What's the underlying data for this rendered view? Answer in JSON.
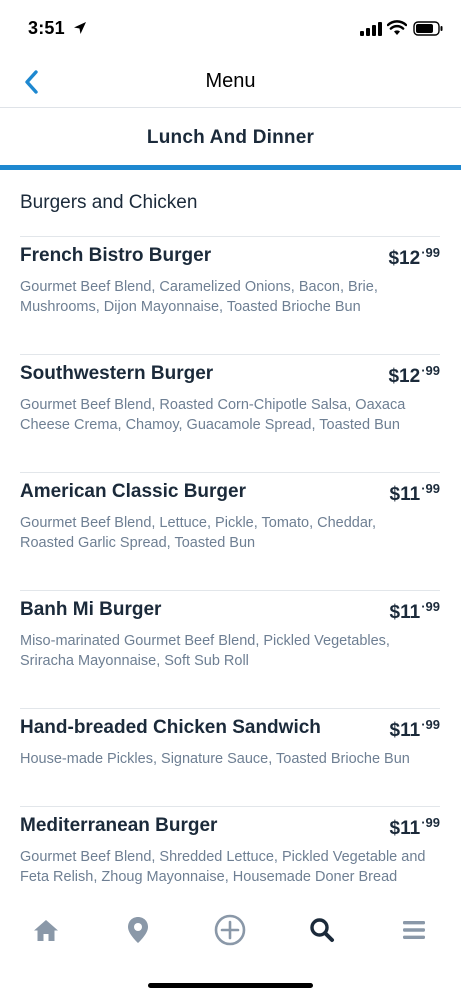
{
  "status_bar": {
    "time": "3:51"
  },
  "nav": {
    "title": "Menu"
  },
  "tab": {
    "label": "Lunch And Dinner"
  },
  "section": {
    "heading": "Burgers and Chicken"
  },
  "items": [
    {
      "name": "French Bistro Burger",
      "price_dollars": "$12",
      "price_cents": "99",
      "desc_line1": "Gourmet Beef Blend, Caramelized Onions, Bacon, Brie,",
      "desc_line2": "Mushrooms, Dijon Mayonnaise, Toasted Brioche Bun"
    },
    {
      "name": "Southwestern Burger",
      "price_dollars": "$12",
      "price_cents": "99",
      "desc_line1": "Gourmet Beef Blend, Roasted Corn-Chipotle Salsa, Oaxaca",
      "desc_line2": "Cheese Crema, Chamoy, Guacamole Spread, Toasted Bun"
    },
    {
      "name": "American Classic Burger",
      "price_dollars": "$11",
      "price_cents": "99",
      "desc_line1": "Gourmet Beef Blend, Lettuce, Pickle, Tomato, Cheddar,",
      "desc_line2": "Roasted Garlic Spread, Toasted Bun"
    },
    {
      "name": "Banh Mi Burger",
      "price_dollars": "$11",
      "price_cents": "99",
      "desc_line1": "Miso-marinated Gourmet Beef Blend, Pickled Vegetables,",
      "desc_line2": "Sriracha Mayonnaise, Soft Sub Roll"
    },
    {
      "name": "Hand-breaded Chicken Sandwich",
      "price_dollars": "$11",
      "price_cents": "99",
      "desc_line1": "House-made Pickles, Signature Sauce, Toasted Brioche Bun",
      "desc_line2": ""
    },
    {
      "name": "Mediterranean Burger",
      "price_dollars": "$11",
      "price_cents": "99",
      "desc_line1": "Gourmet Beef Blend, Shredded Lettuce, Pickled Vegetable and",
      "desc_line2": "Feta Relish, Zhoug Mayonnaise, Housemade Doner Bread"
    }
  ],
  "bottom_tabs": [
    {
      "icon": "home-icon"
    },
    {
      "icon": "location-pin-icon"
    },
    {
      "icon": "plus-circle-icon"
    },
    {
      "icon": "search-icon"
    },
    {
      "icon": "menu-icon"
    }
  ],
  "colors": {
    "accent": "#1e88d0",
    "text": "#1b2a3a",
    "muted": "#6e7f93",
    "icon_inactive": "#8a98a8"
  }
}
